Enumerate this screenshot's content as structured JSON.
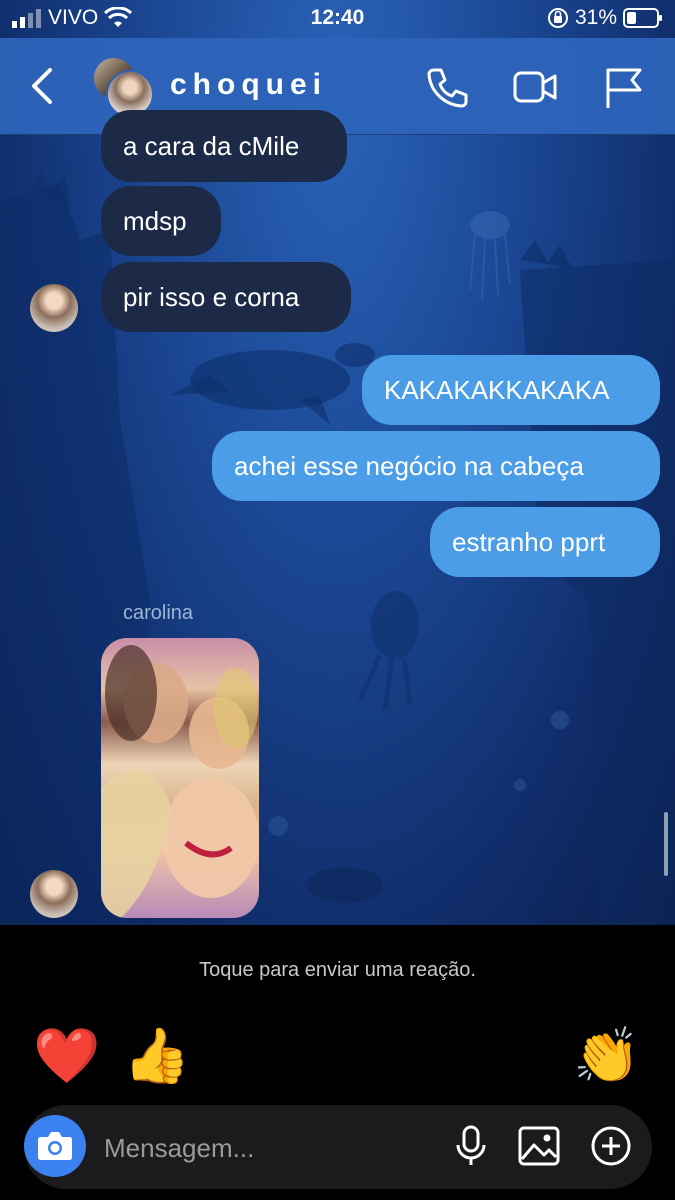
{
  "status_bar": {
    "carrier": "VIVO",
    "time": "12:40",
    "battery": "31%"
  },
  "header": {
    "title": "choquei"
  },
  "messages": [
    {
      "text": "a cara da cMile",
      "dir": "in"
    },
    {
      "text": "mdsp",
      "dir": "in"
    },
    {
      "text": "pir isso e corna",
      "dir": "in"
    },
    {
      "text": "KAKAKAKKAKAKA",
      "dir": "out"
    },
    {
      "text": "achei esse negócio na cabeça",
      "dir": "out"
    },
    {
      "text": "estranho pprt",
      "dir": "out"
    }
  ],
  "photo_message": {
    "sender": "carolina"
  },
  "reaction_bar": {
    "hint": "Toque para enviar uma reação.",
    "emojis": [
      "❤️",
      "👍",
      "😢",
      "😍",
      "😮",
      "😂",
      "👏"
    ]
  },
  "composer": {
    "placeholder": "Mensagem..."
  },
  "colors": {
    "header": "#2d64b9",
    "outgoing_bubble": "#4a9de6",
    "incoming_bubble": "#1c2a47",
    "camera_button": "#3b82f0"
  }
}
